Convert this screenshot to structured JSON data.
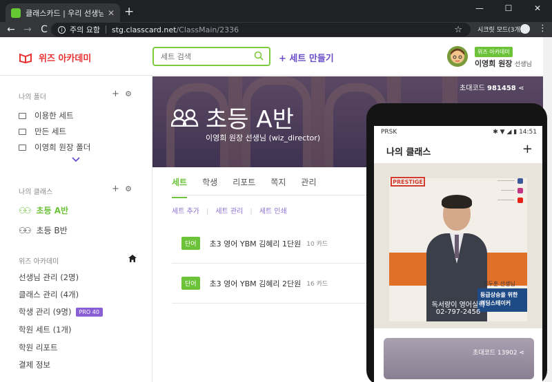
{
  "browser": {
    "tab_title": "클래스카드 | 우리 선생님이 만든",
    "new_tab": "+",
    "close": "✕",
    "win_min": "—",
    "win_max": "☐",
    "win_close": "✕",
    "back": "←",
    "forward": "→",
    "reload": "C",
    "security_warning": "주의 요함",
    "host": "stg.classcard.net",
    "path": "/ClassMain/2336",
    "incognito_label": "시크릿 모드(3개)",
    "menu": "⋮"
  },
  "header": {
    "brand_name": "위즈 아카데미",
    "search_placeholder": "세트 검색",
    "make_set": "+ 세트 만들기",
    "user_badge": "위즈 아카데미",
    "user_name": "이영희 원장",
    "user_role": "선생님"
  },
  "sidebar": {
    "folders_head": "나의 폴더",
    "folders": [
      {
        "label": "이용한 세트"
      },
      {
        "label": "만든 세트"
      },
      {
        "label": "이영희 원장 폴더"
      }
    ],
    "classes_head": "나의 클래스",
    "classes": [
      {
        "label": "초등 A반",
        "active": true
      },
      {
        "label": "초등 B반",
        "active": false
      }
    ],
    "academy_head": "위즈 아카데미",
    "admin": [
      {
        "label": "선생님 관리 (2명)"
      },
      {
        "label": "클래스 관리 (4개)"
      },
      {
        "label": "학생 관리 (9명)",
        "badge": "PRO 40"
      },
      {
        "label": "학원 세트 (1개)"
      },
      {
        "label": "학원 리포트"
      },
      {
        "label": "결제 정보"
      }
    ]
  },
  "hero": {
    "invite_label": "초대코드",
    "invite_code": "981458",
    "class_name": "초등 A반",
    "owner": "이영희 원장 선생님 (wiz_director)"
  },
  "content": {
    "tabs": [
      "세트",
      "학생",
      "리포트",
      "쪽지",
      "관리"
    ],
    "active_tab": "세트",
    "actions": [
      "세트 추가",
      "세트 관리",
      "세트 인쇄"
    ],
    "sets": [
      {
        "type": "단어",
        "title": "초3 영어 YBM 김혜리 1단원",
        "count": "10 카드"
      },
      {
        "type": "단어",
        "title": "초3 영어 YBM 김혜리 2단원",
        "count": "16 카드"
      }
    ]
  },
  "mobile": {
    "carrier": "PRSK",
    "time": "14:51",
    "title": "나의 클래스",
    "add": "+",
    "banner_logo": "PRESTIGE",
    "teacher_label": "김두훈 선생님",
    "book_line1": "등급상승을 위한",
    "book_line2": "리딩스테이커",
    "caption_line1": "독서량이 영어실력",
    "caption_line2": "02-797-2456",
    "card_code": "초대코드 13902"
  },
  "colors": {
    "brand_red": "#e8302f",
    "accent_green": "#6cc33a",
    "accent_purple": "#6a4cc8"
  }
}
